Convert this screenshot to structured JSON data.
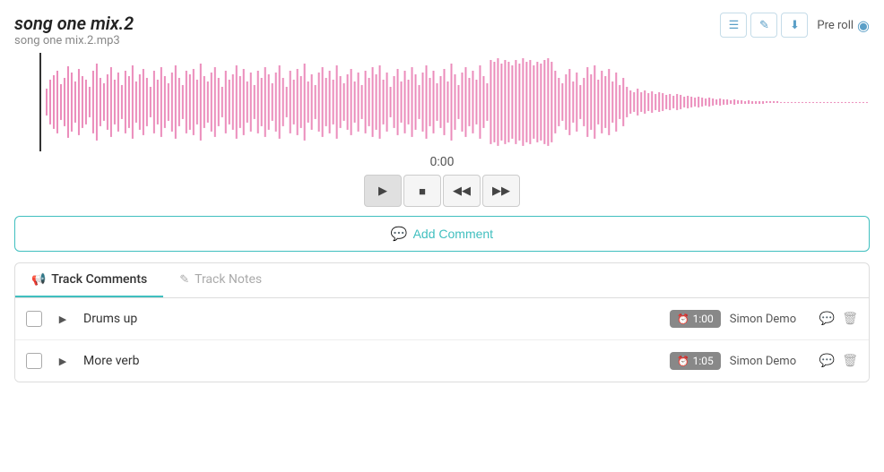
{
  "header": {
    "title": "song one mix.2",
    "filename": "song one mix.2.mp3",
    "preroll_label": "Pre roll",
    "icons": {
      "list": "☰",
      "edit": "✎",
      "download": "⬇"
    }
  },
  "transport": {
    "time": "0:00",
    "play_label": "▶",
    "stop_label": "■",
    "rewind_label": "◀◀",
    "forward_label": "▶▶"
  },
  "add_comment": {
    "label": "Add Comment"
  },
  "tabs": [
    {
      "id": "comments",
      "label": "Track Comments",
      "active": true
    },
    {
      "id": "notes",
      "label": "Track Notes",
      "active": false
    }
  ],
  "comments": [
    {
      "id": 1,
      "text": "Drums up",
      "time": "1:00",
      "author": "Simon Demo"
    },
    {
      "id": 2,
      "text": "More verb",
      "time": "1:05",
      "author": "Simon Demo"
    }
  ],
  "waveform": {
    "color": "#e879b0",
    "background": "#fff"
  }
}
